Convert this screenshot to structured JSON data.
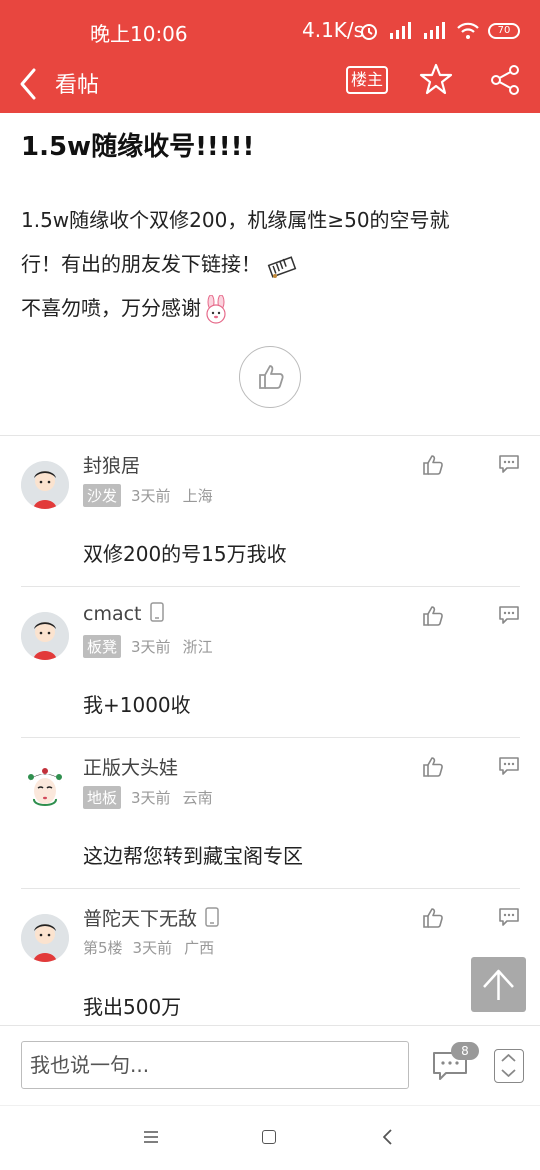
{
  "status_bar": {
    "time": "晚上10:06",
    "speed": "4.1K/s",
    "battery": "70"
  },
  "header": {
    "title": "看帖",
    "louzhu_label": "楼主"
  },
  "post": {
    "title": "1.5w随缘收号!!!!!",
    "lines": [
      "1.5w随缘收个双修200，机缘属性≥50的空号就",
      "行！有出的朋友发下链接！",
      "不喜勿喷，万分感谢"
    ]
  },
  "comments": [
    {
      "name": "封狼居",
      "tag": "沙发",
      "time": "3天前",
      "location": "上海",
      "text": "双修200的号15万我收",
      "has_phone_icon": false
    },
    {
      "name": "cmact",
      "tag": "板凳",
      "time": "3天前",
      "location": "浙江",
      "text": "我+1000收",
      "has_phone_icon": true
    },
    {
      "name": "正版大头娃",
      "tag": "地板",
      "time": "3天前",
      "location": "云南",
      "text": "这边帮您转到藏宝阁专区",
      "has_phone_icon": false
    },
    {
      "name": "普陀天下无敌",
      "floor": "第5楼",
      "time": "3天前",
      "location": "广西",
      "text": "我出500万",
      "has_phone_icon": true
    }
  ],
  "bottom_bar": {
    "input_placeholder": "我也说一句...",
    "comment_count": "8"
  },
  "colors": {
    "header_red": "#e8463f"
  }
}
